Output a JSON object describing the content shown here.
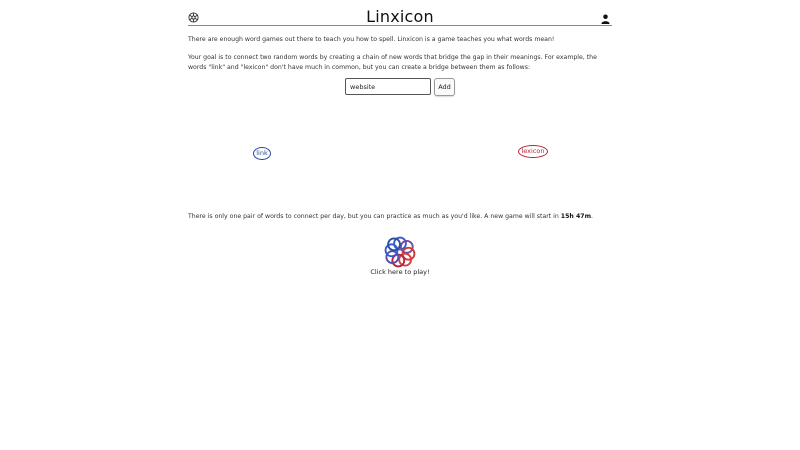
{
  "header": {
    "title": "Linxicon",
    "settings_icon": "settings-icon",
    "user_icon": "user-icon"
  },
  "intro": {
    "paragraph_1": "There are enough word games out there to teach you how to spell. Linxicon is a game teaches you what words mean!",
    "paragraph_2": "Your goal is to connect two random words by creating a chain of new words that bridge the gap in their meanings. For example, the words \"link\" and \"lexicon\" don't have much in common, but you can create a bridge between them as follows:"
  },
  "demo": {
    "input_value": "website",
    "add_label": "Add",
    "start_word": "link",
    "end_word": "lexicon"
  },
  "daily": {
    "text": "There is only one pair of words to connect per day, but you can practice as much as you'd like. A new game will start in ",
    "countdown": "15h 47m",
    "suffix": "."
  },
  "play": {
    "label": "Click here to play!",
    "logo_icon": "linxicon-logo-icon"
  },
  "colors": {
    "start_word": "#2a4fa0",
    "end_word": "#b8263a"
  }
}
